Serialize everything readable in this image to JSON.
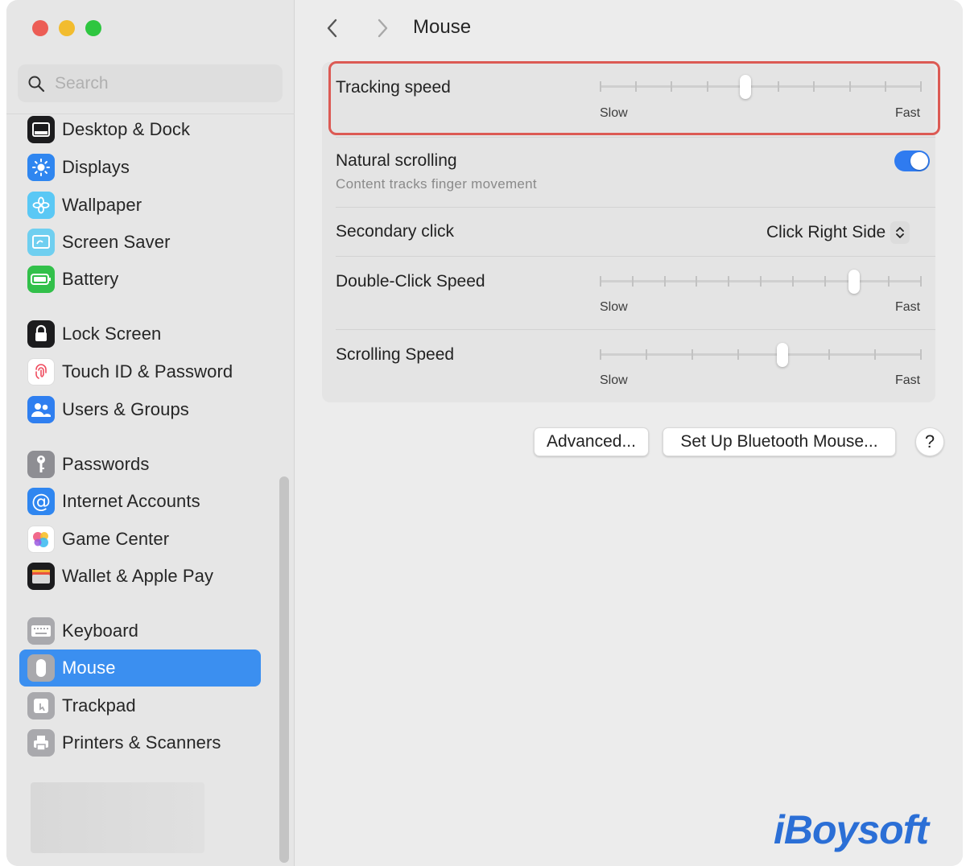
{
  "window": {
    "title": "Mouse"
  },
  "sidebar": {
    "search_placeholder": "Search",
    "items": [
      {
        "label": "Desktop & Dock",
        "icon": "desktop-dock-icon",
        "color": "#1c1c1e"
      },
      {
        "label": "Displays",
        "icon": "displays-icon",
        "color": "#2f86f0"
      },
      {
        "label": "Wallpaper",
        "icon": "wallpaper-icon",
        "color": "#5ac8f5"
      },
      {
        "label": "Screen Saver",
        "icon": "screen-saver-icon",
        "color": "#6fcff0"
      },
      {
        "label": "Battery",
        "icon": "battery-icon",
        "color": "#32c04a"
      },
      {
        "label": "Lock Screen",
        "icon": "lock-icon",
        "color": "#1c1c1e"
      },
      {
        "label": "Touch ID & Password",
        "icon": "fingerprint-icon",
        "color": "#ffffff"
      },
      {
        "label": "Users & Groups",
        "icon": "users-icon",
        "color": "#2f7ff0"
      },
      {
        "label": "Passwords",
        "icon": "key-icon",
        "color": "#8e8e93"
      },
      {
        "label": "Internet Accounts",
        "icon": "at-sign-icon",
        "color": "#2f86f0"
      },
      {
        "label": "Game Center",
        "icon": "game-center-icon",
        "color": "#ffffff"
      },
      {
        "label": "Wallet & Apple Pay",
        "icon": "wallet-icon",
        "color": "#1c1c1e"
      },
      {
        "label": "Keyboard",
        "icon": "keyboard-icon",
        "color": "#a9a9ad"
      },
      {
        "label": "Mouse",
        "icon": "mouse-icon",
        "color": "#a9a9ad",
        "selected": true
      },
      {
        "label": "Trackpad",
        "icon": "trackpad-icon",
        "color": "#a9a9ad"
      },
      {
        "label": "Printers & Scanners",
        "icon": "printer-icon",
        "color": "#a9a9ad"
      }
    ],
    "selected_color": "#3b8ff0"
  },
  "settings": {
    "tracking_speed": {
      "label": "Tracking speed",
      "min_label": "Slow",
      "max_label": "Fast",
      "value": 0.45,
      "ticks": 10
    },
    "natural_scrolling": {
      "label": "Natural scrolling",
      "sublabel": "Content tracks finger movement",
      "enabled": true
    },
    "secondary_click": {
      "label": "Secondary click",
      "value": "Click Right Side"
    },
    "double_click_speed": {
      "label": "Double-Click Speed",
      "min_label": "Slow",
      "max_label": "Fast",
      "value": 0.8,
      "ticks": 11
    },
    "scrolling_speed": {
      "label": "Scrolling Speed",
      "min_label": "Slow",
      "max_label": "Fast",
      "value": 0.57,
      "ticks": 8
    }
  },
  "buttons": {
    "advanced": "Advanced...",
    "bluetooth": "Set Up Bluetooth Mouse...",
    "help": "?"
  },
  "watermark": "iBoysoft",
  "colors": {
    "highlight": "#dc5a54",
    "toggle_on": "#2f7bf0",
    "accent": "#3b8ff0"
  }
}
